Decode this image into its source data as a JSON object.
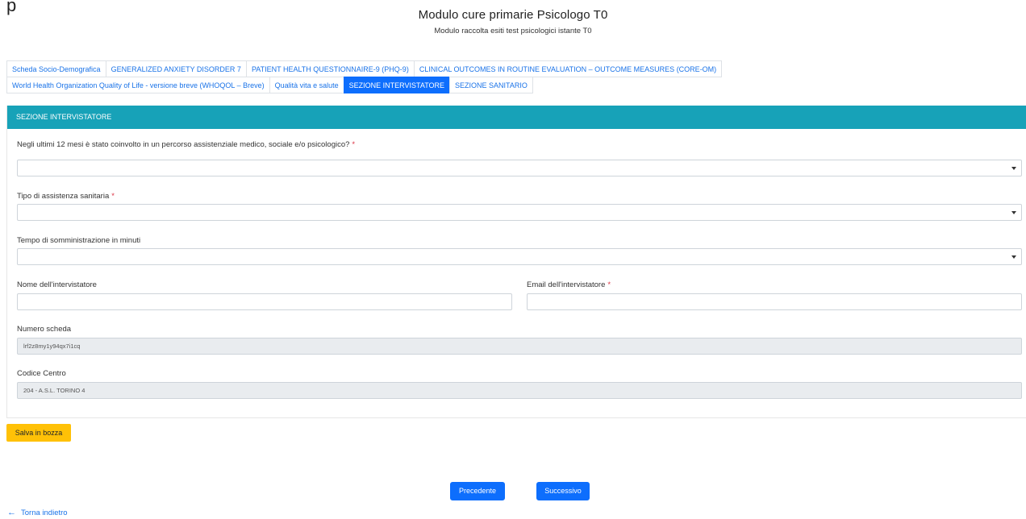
{
  "header": {
    "title": "Modulo cure primarie Psicologo T0",
    "subtitle": "Modulo raccolta esiti test psicologici istante T0"
  },
  "tabs": [
    {
      "label": "Scheda Socio-Demografica",
      "active": false
    },
    {
      "label": "GENERALIZED ANXIETY DISORDER 7",
      "active": false
    },
    {
      "label": "PATIENT HEALTH QUESTIONNAIRE-9 (PHQ-9)",
      "active": false
    },
    {
      "label": "CLINICAL OUTCOMES IN ROUTINE EVALUATION – OUTCOME MEASURES (CORE-OM)",
      "active": false
    },
    {
      "label": "World Health Organization Quality of Life - versione breve (WHOQOL – Breve)",
      "active": false
    },
    {
      "label": "Qualità vita e salute",
      "active": false
    },
    {
      "label": "SEZIONE INTERVISTATORE",
      "active": true
    },
    {
      "label": "SEZIONE SANITARIO",
      "active": false
    }
  ],
  "panel": {
    "heading": "SEZIONE INTERVISTATORE"
  },
  "fields": {
    "percorso": {
      "label": "Negli ultimi 12 mesi è stato coinvolto in un percorso assistenziale medico, sociale e/o psicologico?",
      "required": "*",
      "value": ""
    },
    "tipo_assistenza": {
      "label": "Tipo di assistenza sanitaria",
      "required": "*",
      "value": ""
    },
    "tempo": {
      "label": "Tempo di somministrazione in minuti",
      "value": ""
    },
    "nome": {
      "label": "Nome dell'intervistatore",
      "value": ""
    },
    "email": {
      "label": "Email dell'intervistatore",
      "required": "*",
      "value": ""
    },
    "numero_scheda": {
      "label": "Numero scheda",
      "value": "lrf2z8my1y94qx7i1cq"
    },
    "codice_centro": {
      "label": "Codice Centro",
      "value": "204 - A.S.L. TORINO 4"
    }
  },
  "buttons": {
    "draft": "Salva in bozza",
    "previous": "Precedente",
    "next": "Successivo"
  },
  "back_link": {
    "arrow": "←",
    "label": "Torna indietro"
  },
  "colors": {
    "panel_header": "#17a2b8",
    "active_tab": "#0d6efd",
    "draft_button": "#ffc107",
    "primary_button": "#0d6efd",
    "required": "#dc3545"
  }
}
